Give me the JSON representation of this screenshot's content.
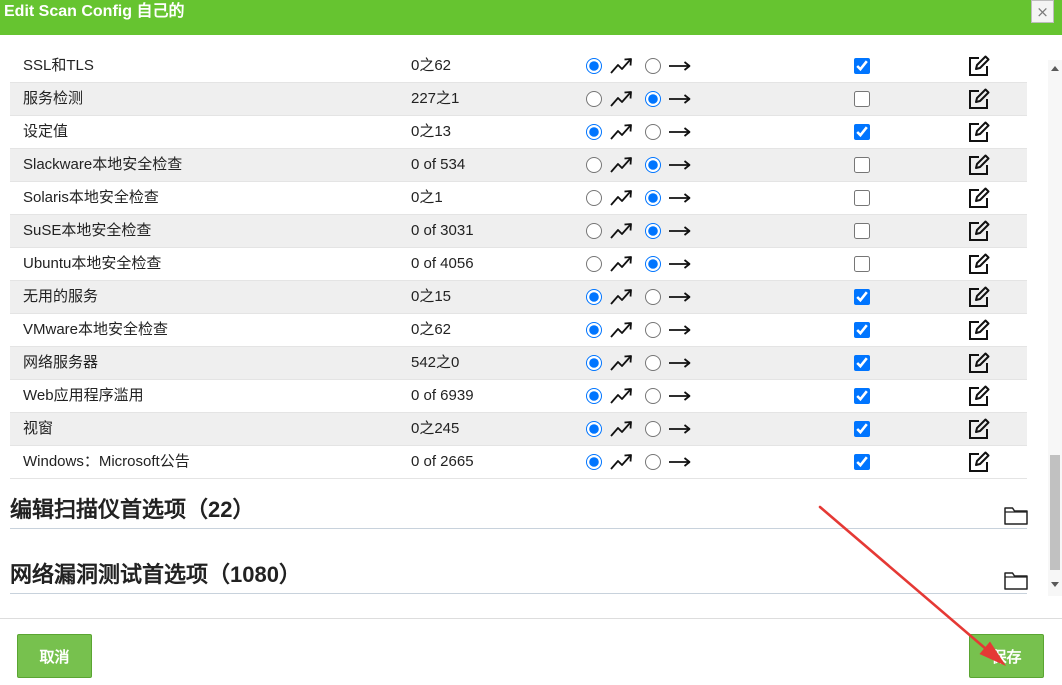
{
  "dialog": {
    "title": "Edit Scan Config 自己的",
    "close_icon": "×"
  },
  "families": [
    {
      "name": "SSL和TLS",
      "count": "0之62",
      "trend": "dynamic",
      "selected": true
    },
    {
      "name": "服务检测",
      "count": "227之1",
      "trend": "static",
      "selected": false
    },
    {
      "name": "设定值",
      "count": "0之13",
      "trend": "dynamic",
      "selected": true
    },
    {
      "name": "Slackware本地安全检查",
      "count": "0 of 534",
      "trend": "static",
      "selected": false
    },
    {
      "name": "Solaris本地安全检查",
      "count": "0之1",
      "trend": "static",
      "selected": false
    },
    {
      "name": "SuSE本地安全检查",
      "count": "0 of 3031",
      "trend": "static",
      "selected": false
    },
    {
      "name": "Ubuntu本地安全检查",
      "count": "0 of 4056",
      "trend": "static",
      "selected": false
    },
    {
      "name": "无用的服务",
      "count": "0之15",
      "trend": "dynamic",
      "selected": true
    },
    {
      "name": "VMware本地安全检查",
      "count": "0之62",
      "trend": "dynamic",
      "selected": true
    },
    {
      "name": "网络服务器",
      "count": "542之0",
      "trend": "dynamic",
      "selected": true
    },
    {
      "name": "Web应用程序滥用",
      "count": "0 of 6939",
      "trend": "dynamic",
      "selected": true
    },
    {
      "name": "视窗",
      "count": "0之245",
      "trend": "dynamic",
      "selected": true
    },
    {
      "name": "Windows：Microsoft公告",
      "count": "0 of 2665",
      "trend": "dynamic",
      "selected": true
    }
  ],
  "sections": [
    {
      "title": "编辑扫描仪首选项（22）",
      "icon": "folder-icon"
    },
    {
      "title": "网络漏洞测试首选项（1080）",
      "icon": "folder-icon"
    }
  ],
  "footer": {
    "cancel_label": "取消",
    "save_label": "保存"
  },
  "icons": {
    "dynamic_trend": "trend-dynamic-icon",
    "static_trend": "trend-static-icon",
    "edit": "edit-icon",
    "close": "close-icon",
    "section_toggle": "folder-icon"
  },
  "colors": {
    "header": "#66c430",
    "button": "#77c14e",
    "accent": "#0075ff",
    "annotation": "#e53935"
  }
}
